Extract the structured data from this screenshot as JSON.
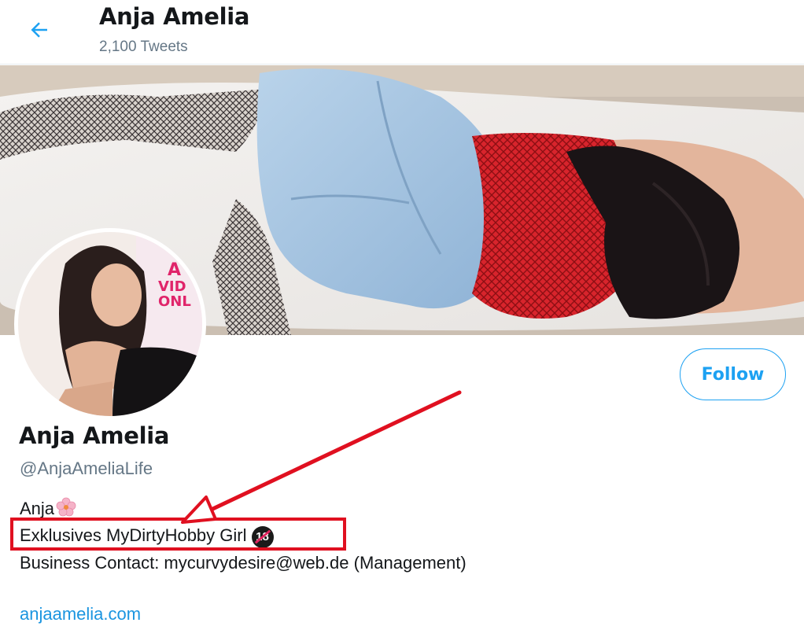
{
  "header": {
    "title": "Anja Amelia",
    "tweet_count": "2,100 Tweets"
  },
  "icons": {
    "back": "arrow-left-icon",
    "flower": "cherry-blossom-icon",
    "adult": "no-one-under-18-icon"
  },
  "profile": {
    "name": "Anja Amelia",
    "handle": "@AnjaAmeliaLife",
    "bio": {
      "line1": "Anja",
      "line2": "Exklusives MyDirtyHobby Girl",
      "line2_badge": "18",
      "line3": "Business Contact: mycurvydesire@web.de (Management)"
    },
    "website": "anjaamelia.com"
  },
  "actions": {
    "follow_label": "Follow"
  },
  "colors": {
    "accent": "#1da1f2",
    "link": "#1b95e0",
    "secondary_text": "#657786",
    "annotation": "#e01020"
  }
}
